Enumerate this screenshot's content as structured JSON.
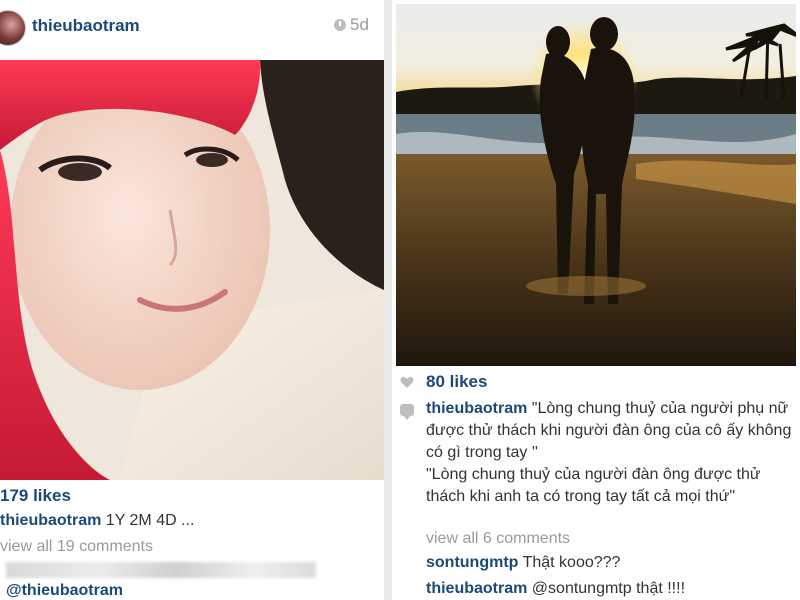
{
  "left_post": {
    "username": "thieubaotram",
    "age": "5d",
    "likes": "179 likes",
    "caption_user": "thieubaotram",
    "caption_text": "1Y 2M 4D ...",
    "view_comments": "view all 19 comments",
    "comment_mention": "@thieubaotram"
  },
  "right_post": {
    "likes": "80 likes",
    "caption_user": "thieubaotram",
    "caption_line1": "\"Lòng chung thuỷ của người phụ nữ được thử thách khi người đàn ông của cô ấy không có gì trong tay ''",
    "caption_line2": "\"Lòng chung thuỷ của người đàn ông được thử thách khi anh ta có trong tay tất cả mọi thứ\"",
    "view_comments": "view all 6 comments",
    "comments": [
      {
        "user": "sontungmtp",
        "text": "Thật kooo???"
      },
      {
        "user": "thieubaotram",
        "text": "@sontungmtp thật !!!!"
      }
    ]
  },
  "colors": {
    "username": "#1b4a7a",
    "muted": "#9a9a9a",
    "hair": "#e2344a"
  },
  "icons": [
    "clock-icon",
    "heart-icon",
    "comment-icon"
  ]
}
